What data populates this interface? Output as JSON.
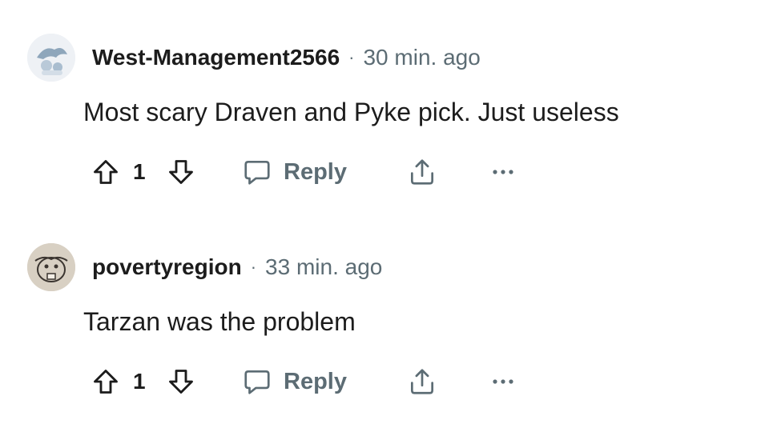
{
  "comments": [
    {
      "username": "West-Management2566",
      "separator": "·",
      "time": "30 min. ago",
      "body": "Most scary Draven and Pyke pick. Just useless",
      "score": "1",
      "reply_label": "Reply"
    },
    {
      "username": "povertyregion",
      "separator": "·",
      "time": "33 min. ago",
      "body": "Tarzan was the problem",
      "score": "1",
      "reply_label": "Reply"
    }
  ],
  "icons": {
    "upvote": "arrow-up-outline-icon",
    "downvote": "arrow-down-outline-icon",
    "reply": "speech-bubble-icon",
    "share": "share-upload-icon",
    "more": "more-horizontal-icon"
  },
  "colors": {
    "text": "#1c1c1c",
    "muted": "#5c6c74",
    "background": "#ffffff"
  }
}
